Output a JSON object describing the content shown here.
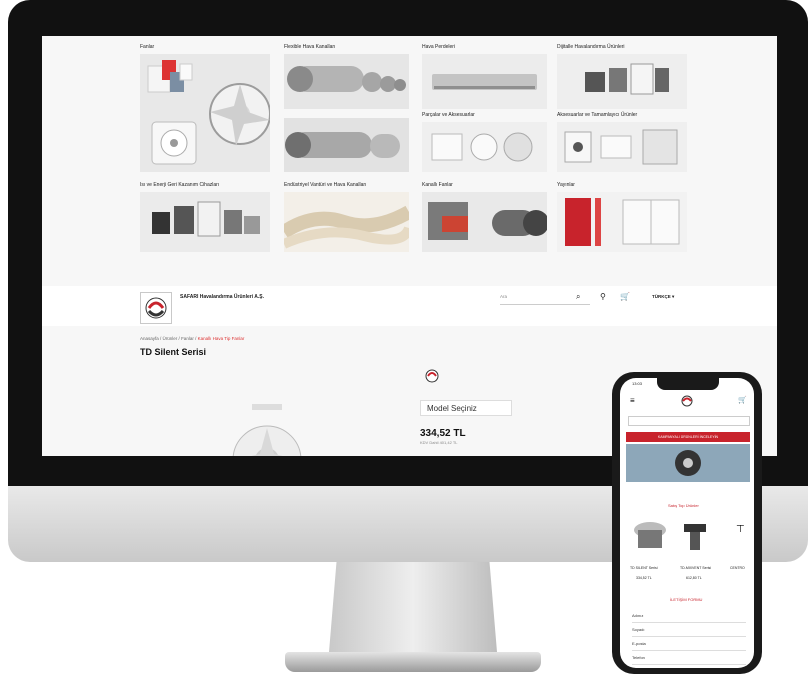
{
  "categories": [
    {
      "title": "Fanlar"
    },
    {
      "title": "Flexible Hava Kanalları"
    },
    {
      "title": "Hava Perdeleri"
    },
    {
      "title": "Dijitalle Havalandırma Ürünleri"
    },
    {
      "title": "Parçalar ve Aksesuarlar"
    },
    {
      "title": "Aksesuarlar ve Tamamlayıcı Ürünler"
    },
    {
      "title": "Isı ve Enerji Geri Kazanım Cihazları"
    },
    {
      "title": "Endüstriyel Vantüri ve Hava Kanalları"
    },
    {
      "title": "Kanallı Fanlar"
    },
    {
      "title": "Yayınlar"
    }
  ],
  "header": {
    "company": "SAFARI Havalandırma Ürünleri A.Ş.",
    "search_placeholder": "Ara",
    "language": "TÜRKÇE"
  },
  "breadcrumb": {
    "items": [
      "Anasayfa",
      "Ürünler",
      "Fanlar"
    ],
    "active": "Kanallı Hava Tip Fanlar"
  },
  "product": {
    "title": "TD Silent Serisi",
    "model_select": "Model Seçiniz",
    "price": "334,52 TL",
    "vat_note": "KDV Dahil 401,42 TL"
  },
  "phone": {
    "time": "13:03",
    "banner_text": "KAMPANYALI ÜRÜNLERİ İNCELEYİN",
    "section_title": "Satış Top Ürünler",
    "product_labels": [
      "TD SILENT Serisi",
      "TD-MIXVENT Serisi",
      "CENTRO"
    ],
    "product_prices": [
      "334,52 TL",
      "612,80 TL"
    ],
    "form_title": "İLETİŞİM FORMU",
    "form_fields": [
      "Adınız",
      "Soyadı",
      "E-posta",
      "Telefon"
    ]
  },
  "colors": {
    "accent": "#c8232c",
    "bezel": "#111111",
    "screen_bg": "#f7f7f7"
  }
}
